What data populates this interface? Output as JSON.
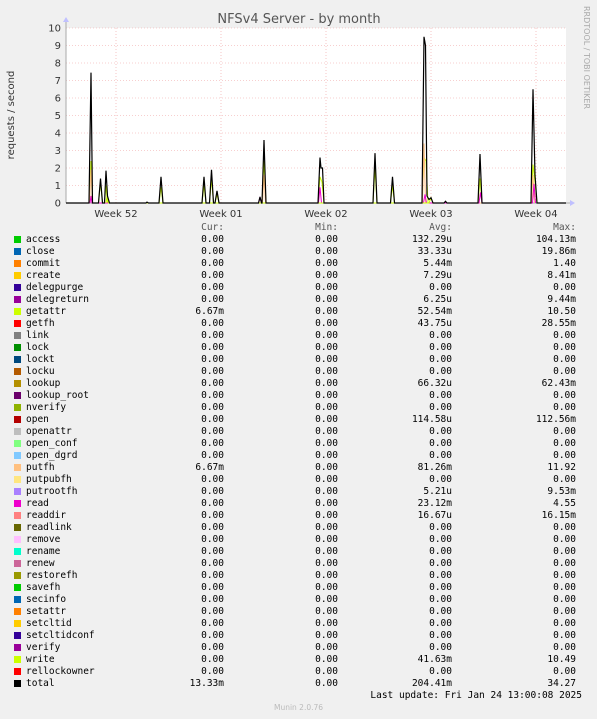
{
  "side_label": "RRDTOOL / TOBI OETIKER",
  "footer": {
    "last_update": "Last update: Fri Jan 24 13:00:08 2025",
    "version": "Munin 2.0.76"
  },
  "legend_headers": {
    "cur": "Cur:",
    "min": "Min:",
    "avg": "Avg:",
    "max": "Max:"
  },
  "legend": [
    {
      "name": "access",
      "color": "#00cc00",
      "cur": "0.00",
      "min": "0.00",
      "avg": "132.29u",
      "max": "104.13m"
    },
    {
      "name": "close",
      "color": "#0066b3",
      "cur": "0.00",
      "min": "0.00",
      "avg": "33.33u",
      "max": "19.86m"
    },
    {
      "name": "commit",
      "color": "#ff8000",
      "cur": "0.00",
      "min": "0.00",
      "avg": "5.44m",
      "max": "1.40"
    },
    {
      "name": "create",
      "color": "#ffcc00",
      "cur": "0.00",
      "min": "0.00",
      "avg": "7.29u",
      "max": "8.41m"
    },
    {
      "name": "delegpurge",
      "color": "#330099",
      "cur": "0.00",
      "min": "0.00",
      "avg": "0.00",
      "max": "0.00"
    },
    {
      "name": "delegreturn",
      "color": "#990099",
      "cur": "0.00",
      "min": "0.00",
      "avg": "6.25u",
      "max": "9.44m"
    },
    {
      "name": "getattr",
      "color": "#ccff00",
      "cur": "6.67m",
      "min": "0.00",
      "avg": "52.54m",
      "max": "10.50"
    },
    {
      "name": "getfh",
      "color": "#ff0000",
      "cur": "0.00",
      "min": "0.00",
      "avg": "43.75u",
      "max": "28.55m"
    },
    {
      "name": "link",
      "color": "#808080",
      "cur": "0.00",
      "min": "0.00",
      "avg": "0.00",
      "max": "0.00"
    },
    {
      "name": "lock",
      "color": "#008f00",
      "cur": "0.00",
      "min": "0.00",
      "avg": "0.00",
      "max": "0.00"
    },
    {
      "name": "lockt",
      "color": "#00487d",
      "cur": "0.00",
      "min": "0.00",
      "avg": "0.00",
      "max": "0.00"
    },
    {
      "name": "locku",
      "color": "#b35a00",
      "cur": "0.00",
      "min": "0.00",
      "avg": "0.00",
      "max": "0.00"
    },
    {
      "name": "lookup",
      "color": "#b38f00",
      "cur": "0.00",
      "min": "0.00",
      "avg": "66.32u",
      "max": "62.43m"
    },
    {
      "name": "lookup_root",
      "color": "#6b006b",
      "cur": "0.00",
      "min": "0.00",
      "avg": "0.00",
      "max": "0.00"
    },
    {
      "name": "nverify",
      "color": "#8fb300",
      "cur": "0.00",
      "min": "0.00",
      "avg": "0.00",
      "max": "0.00"
    },
    {
      "name": "open",
      "color": "#b30000",
      "cur": "0.00",
      "min": "0.00",
      "avg": "114.58u",
      "max": "112.56m"
    },
    {
      "name": "openattr",
      "color": "#bebebe",
      "cur": "0.00",
      "min": "0.00",
      "avg": "0.00",
      "max": "0.00"
    },
    {
      "name": "open_conf",
      "color": "#80ff80",
      "cur": "0.00",
      "min": "0.00",
      "avg": "0.00",
      "max": "0.00"
    },
    {
      "name": "open_dgrd",
      "color": "#80c9ff",
      "cur": "0.00",
      "min": "0.00",
      "avg": "0.00",
      "max": "0.00"
    },
    {
      "name": "putfh",
      "color": "#ffc080",
      "cur": "6.67m",
      "min": "0.00",
      "avg": "81.26m",
      "max": "11.92"
    },
    {
      "name": "putpubfh",
      "color": "#ffe680",
      "cur": "0.00",
      "min": "0.00",
      "avg": "0.00",
      "max": "0.00"
    },
    {
      "name": "putrootfh",
      "color": "#aa80ff",
      "cur": "0.00",
      "min": "0.00",
      "avg": "5.21u",
      "max": "9.53m"
    },
    {
      "name": "read",
      "color": "#ee00cc",
      "cur": "0.00",
      "min": "0.00",
      "avg": "23.12m",
      "max": "4.55"
    },
    {
      "name": "readdir",
      "color": "#ff8080",
      "cur": "0.00",
      "min": "0.00",
      "avg": "16.67u",
      "max": "16.15m"
    },
    {
      "name": "readlink",
      "color": "#666600",
      "cur": "0.00",
      "min": "0.00",
      "avg": "0.00",
      "max": "0.00"
    },
    {
      "name": "remove",
      "color": "#ffbfff",
      "cur": "0.00",
      "min": "0.00",
      "avg": "0.00",
      "max": "0.00"
    },
    {
      "name": "rename",
      "color": "#00ffcc",
      "cur": "0.00",
      "min": "0.00",
      "avg": "0.00",
      "max": "0.00"
    },
    {
      "name": "renew",
      "color": "#cc6699",
      "cur": "0.00",
      "min": "0.00",
      "avg": "0.00",
      "max": "0.00"
    },
    {
      "name": "restorefh",
      "color": "#999900",
      "cur": "0.00",
      "min": "0.00",
      "avg": "0.00",
      "max": "0.00"
    },
    {
      "name": "savefh",
      "color": "#00cc00",
      "cur": "0.00",
      "min": "0.00",
      "avg": "0.00",
      "max": "0.00"
    },
    {
      "name": "secinfo",
      "color": "#0066b3",
      "cur": "0.00",
      "min": "0.00",
      "avg": "0.00",
      "max": "0.00"
    },
    {
      "name": "setattr",
      "color": "#ff8000",
      "cur": "0.00",
      "min": "0.00",
      "avg": "0.00",
      "max": "0.00"
    },
    {
      "name": "setcltid",
      "color": "#ffcc00",
      "cur": "0.00",
      "min": "0.00",
      "avg": "0.00",
      "max": "0.00"
    },
    {
      "name": "setcltidconf",
      "color": "#330099",
      "cur": "0.00",
      "min": "0.00",
      "avg": "0.00",
      "max": "0.00"
    },
    {
      "name": "verify",
      "color": "#990099",
      "cur": "0.00",
      "min": "0.00",
      "avg": "0.00",
      "max": "0.00"
    },
    {
      "name": "write",
      "color": "#ccff00",
      "cur": "0.00",
      "min": "0.00",
      "avg": "41.63m",
      "max": "10.49"
    },
    {
      "name": "rellockowner",
      "color": "#ff0000",
      "cur": "0.00",
      "min": "0.00",
      "avg": "0.00",
      "max": "0.00"
    },
    {
      "name": "total",
      "color": "#000000",
      "cur": "13.33m",
      "min": "0.00",
      "avg": "204.41m",
      "max": "34.27"
    }
  ],
  "chart_data": {
    "type": "area",
    "title": "NFSv4 Server - by month",
    "ylabel": "requests / second",
    "xlabel": "",
    "ylim": [
      0,
      10
    ],
    "xlim": [
      0,
      100
    ],
    "yticks": [
      0,
      1,
      2,
      3,
      4,
      5,
      6,
      7,
      8,
      9,
      10
    ],
    "xticks": [
      {
        "label": "Week 52",
        "x": 10
      },
      {
        "label": "Week 01",
        "x": 31
      },
      {
        "label": "Week 02",
        "x": 52
      },
      {
        "label": "Week 03",
        "x": 73
      },
      {
        "label": "Week 04",
        "x": 94
      }
    ],
    "grid": true,
    "series": [
      {
        "name": "getattr",
        "color": "#ccff00",
        "points": [
          [
            4.6,
            0
          ],
          [
            5.0,
            2.4
          ],
          [
            5.3,
            0
          ],
          [
            6.5,
            0
          ],
          [
            6.9,
            1.2
          ],
          [
            7.3,
            0
          ],
          [
            7.7,
            0
          ],
          [
            8.0,
            1.0
          ],
          [
            8.3,
            0
          ],
          [
            18.6,
            0
          ],
          [
            19.0,
            0.9
          ],
          [
            19.4,
            0
          ],
          [
            27.2,
            0
          ],
          [
            27.6,
            1.0
          ],
          [
            28.0,
            0
          ],
          [
            28.7,
            0
          ],
          [
            29.1,
            1.4
          ],
          [
            29.5,
            0
          ],
          [
            29.8,
            0
          ],
          [
            30.2,
            0.5
          ],
          [
            30.6,
            0
          ],
          [
            39.2,
            0
          ],
          [
            39.6,
            2.4
          ],
          [
            40.0,
            0
          ],
          [
            50.4,
            0
          ],
          [
            50.8,
            1.5
          ],
          [
            51.2,
            1.2
          ],
          [
            51.6,
            0
          ],
          [
            61.4,
            0
          ],
          [
            61.8,
            2.0
          ],
          [
            62.2,
            0
          ],
          [
            64.9,
            0
          ],
          [
            65.3,
            1.0
          ],
          [
            65.7,
            0
          ],
          [
            71.2,
            0
          ],
          [
            71.6,
            2.6
          ],
          [
            72.0,
            2.4
          ],
          [
            72.4,
            0
          ],
          [
            82.4,
            0
          ],
          [
            82.8,
            1.4
          ],
          [
            83.2,
            0
          ],
          [
            93.0,
            0
          ],
          [
            93.4,
            2.2
          ],
          [
            93.8,
            1.2
          ],
          [
            94.2,
            0
          ]
        ]
      },
      {
        "name": "putfh",
        "color": "#ffc080",
        "points": [
          [
            4.7,
            0
          ],
          [
            5.0,
            1.9
          ],
          [
            5.3,
            0
          ],
          [
            39.3,
            0
          ],
          [
            39.6,
            1.6
          ],
          [
            39.9,
            0
          ],
          [
            71.3,
            0
          ],
          [
            71.6,
            3.4
          ],
          [
            71.9,
            0
          ],
          [
            93.1,
            0
          ],
          [
            93.4,
            1.6
          ],
          [
            93.7,
            0
          ]
        ]
      },
      {
        "name": "read",
        "color": "#ee00cc",
        "points": [
          [
            4.8,
            0
          ],
          [
            5.0,
            0.4
          ],
          [
            5.2,
            0
          ],
          [
            38.5,
            0
          ],
          [
            38.8,
            0.3
          ],
          [
            39.1,
            0
          ],
          [
            50.5,
            0
          ],
          [
            50.8,
            0.9
          ],
          [
            51.1,
            0
          ],
          [
            71.5,
            0
          ],
          [
            71.8,
            0.5
          ],
          [
            72.1,
            0
          ],
          [
            82.6,
            0
          ],
          [
            82.9,
            0.6
          ],
          [
            83.2,
            0
          ],
          [
            93.3,
            0
          ],
          [
            93.6,
            1.1
          ],
          [
            93.9,
            0
          ]
        ]
      },
      {
        "name": "write",
        "color": "#ccff00",
        "points": [
          [
            8.0,
            0
          ],
          [
            8.2,
            0.4
          ],
          [
            8.5,
            0
          ],
          [
            72.6,
            0
          ],
          [
            73.0,
            0.3
          ],
          [
            73.4,
            0
          ]
        ]
      },
      {
        "name": "total",
        "color": "#000000",
        "points": [
          [
            0,
            0
          ],
          [
            4.6,
            0
          ],
          [
            5.0,
            7.45
          ],
          [
            5.3,
            0
          ],
          [
            6.5,
            0
          ],
          [
            6.9,
            1.4
          ],
          [
            7.3,
            0
          ],
          [
            7.7,
            0
          ],
          [
            8.0,
            1.85
          ],
          [
            8.3,
            0.4
          ],
          [
            8.7,
            0
          ],
          [
            16.0,
            0
          ],
          [
            16.2,
            0.05
          ],
          [
            16.5,
            0
          ],
          [
            18.6,
            0
          ],
          [
            19.0,
            1.5
          ],
          [
            19.4,
            0
          ],
          [
            27.2,
            0
          ],
          [
            27.6,
            1.5
          ],
          [
            28.0,
            0
          ],
          [
            28.7,
            0
          ],
          [
            29.1,
            1.9
          ],
          [
            29.5,
            0
          ],
          [
            29.8,
            0
          ],
          [
            30.2,
            0.7
          ],
          [
            30.6,
            0
          ],
          [
            38.5,
            0
          ],
          [
            38.8,
            0.35
          ],
          [
            39.1,
            0
          ],
          [
            39.2,
            0
          ],
          [
            39.6,
            3.6
          ],
          [
            40.0,
            0
          ],
          [
            50.4,
            0
          ],
          [
            50.8,
            2.6
          ],
          [
            51.0,
            2.0
          ],
          [
            51.3,
            2.0
          ],
          [
            51.6,
            0
          ],
          [
            61.4,
            0
          ],
          [
            61.8,
            2.85
          ],
          [
            62.2,
            0
          ],
          [
            64.9,
            0
          ],
          [
            65.3,
            1.5
          ],
          [
            65.7,
            0
          ],
          [
            71.2,
            0
          ],
          [
            71.6,
            9.5
          ],
          [
            71.9,
            9.0
          ],
          [
            72.2,
            0.4
          ],
          [
            72.6,
            0.2
          ],
          [
            73.0,
            0.3
          ],
          [
            73.4,
            0
          ],
          [
            75.6,
            0
          ],
          [
            75.9,
            0.1
          ],
          [
            76.2,
            0
          ],
          [
            82.4,
            0
          ],
          [
            82.8,
            2.8
          ],
          [
            83.2,
            0
          ],
          [
            93.0,
            0
          ],
          [
            93.4,
            6.5
          ],
          [
            93.8,
            1.6
          ],
          [
            94.2,
            0
          ],
          [
            100,
            0
          ]
        ]
      }
    ]
  }
}
